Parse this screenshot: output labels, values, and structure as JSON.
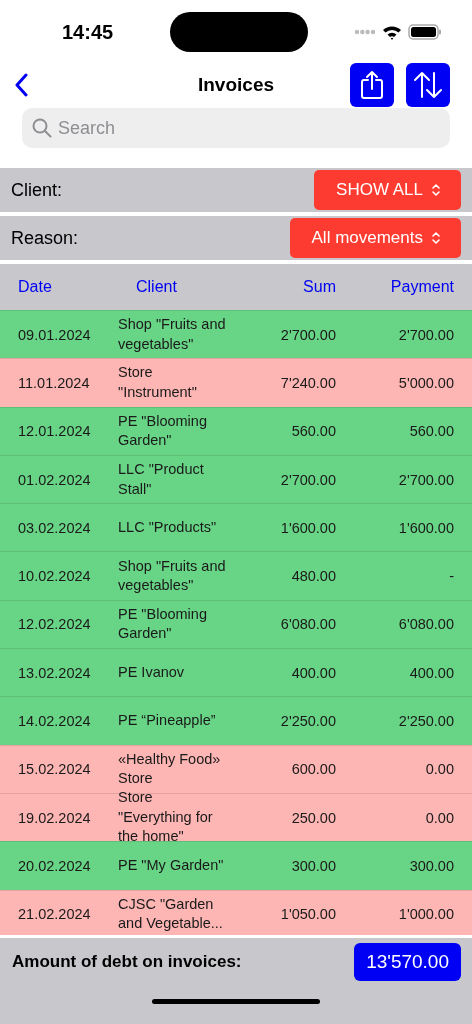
{
  "status_bar": {
    "time": "14:45"
  },
  "nav": {
    "title": "Invoices"
  },
  "search": {
    "placeholder": "Search"
  },
  "filters": [
    {
      "label": "Client:",
      "value": "SHOW ALL"
    },
    {
      "label": "Reason:",
      "value": "All movements"
    }
  ],
  "table": {
    "columns": [
      "Date",
      "Client",
      "Sum",
      "Payment"
    ],
    "rows": [
      {
        "date": "09.01.2024",
        "client": "Shop \"Fruits and vegetables\"",
        "sum": "2'700.00",
        "payment": "2'700.00",
        "color": "#68d586"
      },
      {
        "date": "11.01.2024",
        "client": "Store \"Instrument\"",
        "sum": "7'240.00",
        "payment": "5'000.00",
        "color": "#feb6b4"
      },
      {
        "date": "12.01.2024",
        "client": "PE \"Blooming Garden\"",
        "sum": "560.00",
        "payment": "560.00",
        "color": "#68d586"
      },
      {
        "date": "01.02.2024",
        "client": "LLC \"Product Stall\"",
        "sum": "2'700.00",
        "payment": "2'700.00",
        "color": "#68d586"
      },
      {
        "date": "03.02.2024",
        "client": "LLC \"Products\"",
        "sum": "1'600.00",
        "payment": "1'600.00",
        "color": "#68d586"
      },
      {
        "date": "10.02.2024",
        "client": "Shop \"Fruits and vegetables\"",
        "sum": "480.00",
        "payment": "-",
        "color": "#68d586"
      },
      {
        "date": "12.02.2024",
        "client": "PE \"Blooming Garden\"",
        "sum": "6'080.00",
        "payment": "6'080.00",
        "color": "#68d586"
      },
      {
        "date": "13.02.2024",
        "client": "PE Ivanov",
        "sum": "400.00",
        "payment": "400.00",
        "color": "#68d586"
      },
      {
        "date": "14.02.2024",
        "client": "PE “Pineapple”",
        "sum": "2'250.00",
        "payment": "2'250.00",
        "color": "#68d586"
      },
      {
        "date": "15.02.2024",
        "client": "«Healthy Food» Store",
        "sum": "600.00",
        "payment": "0.00",
        "color": "#feb6b4"
      },
      {
        "date": "19.02.2024",
        "client": "Store \"Everything for the home\"",
        "sum": "250.00",
        "payment": "0.00",
        "color": "#feb6b4"
      },
      {
        "date": "20.02.2024",
        "client": "PE \"My Garden\"",
        "sum": "300.00",
        "payment": "300.00",
        "color": "#68d586"
      },
      {
        "date": "21.02.2024",
        "client": "CJSC \"Garden and Vegetable...",
        "sum": "1'050.00",
        "payment": "1'000.00",
        "color": "#feb6b4"
      }
    ]
  },
  "footer": {
    "label": "Amount of debt on invoices:",
    "total": "13'570.00"
  }
}
